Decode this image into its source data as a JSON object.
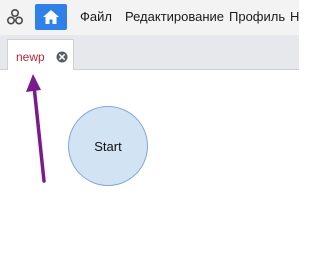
{
  "menubar": {
    "logo_icon": "app-logo-icon",
    "home_icon": "home-icon",
    "accent_color": "#2f80e8",
    "items": [
      {
        "label": "Файл"
      },
      {
        "label": "Редактирование"
      },
      {
        "label": "Профиль"
      },
      {
        "label": "Н"
      }
    ]
  },
  "tabs": [
    {
      "label": "newp",
      "close_icon": "close-circle-icon",
      "label_color": "#c0263b"
    }
  ],
  "canvas": {
    "start_node": {
      "label": "Start"
    },
    "annotation_arrow_color": "#7a1a8c"
  }
}
